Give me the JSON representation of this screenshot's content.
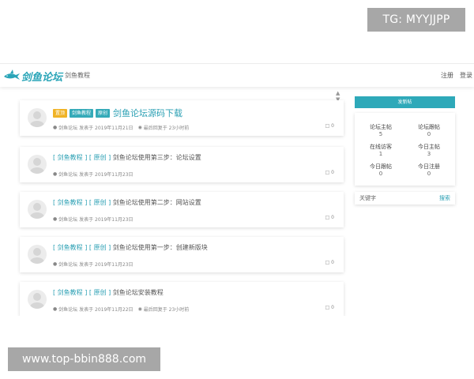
{
  "overlay": {
    "tg_text": "TG: MYYJJPP",
    "url_text": "www.top-bbin888.com"
  },
  "header": {
    "logo_text": "剑鱼论坛",
    "nav_link": "剑鱼教程",
    "register": "注册",
    "login": "登录"
  },
  "posts": [
    {
      "tags": [
        "置顶",
        "剑鱼教程",
        "原创"
      ],
      "title": "剑鱼论坛源码下载",
      "author": "剑鱼论坛",
      "posted": "发表于 2019年11月21日",
      "last_reply": "最后回复于 23小时前",
      "comments": "0"
    },
    {
      "cat1": "[ 剑鱼教程 ]",
      "cat2": "[ 原创 ]",
      "title": "剑鱼论坛使用第三步：论坛设置",
      "author": "剑鱼论坛",
      "posted": "发表于 2019年11月23日",
      "comments": "0"
    },
    {
      "cat1": "[ 剑鱼教程 ]",
      "cat2": "[ 原创 ]",
      "title": "剑鱼论坛使用第二步：网站设置",
      "author": "剑鱼论坛",
      "posted": "发表于 2019年11月23日",
      "comments": "0"
    },
    {
      "cat1": "[ 剑鱼教程 ]",
      "cat2": "[ 原创 ]",
      "title": "剑鱼论坛使用第一步：创建新版块",
      "author": "剑鱼论坛",
      "posted": "发表于 2019年11月23日",
      "comments": "0"
    },
    {
      "cat1": "[ 剑鱼教程 ]",
      "cat2": "[ 原创 ]",
      "title": "剑鱼论坛安装教程",
      "author": "剑鱼论坛",
      "posted": "发表于 2019年11月22日",
      "last_reply": "最后回复于 23小时前",
      "comments": "0"
    }
  ],
  "sidebar": {
    "post_button": "发新帖",
    "stats": [
      {
        "label": "论坛主帖",
        "value": "5"
      },
      {
        "label": "论坛跟帖",
        "value": "0"
      },
      {
        "label": "在线访客",
        "value": "1"
      },
      {
        "label": "今日主帖",
        "value": "3"
      },
      {
        "label": "今日跟帖",
        "value": "0"
      },
      {
        "label": "今日注册",
        "value": "0"
      }
    ],
    "search_label": "关键字",
    "search_button": "搜索"
  },
  "colors": {
    "accent": "#2ea9b9",
    "pin_tag": "#f0b326",
    "overlay_badge": "#a7a7a7"
  }
}
